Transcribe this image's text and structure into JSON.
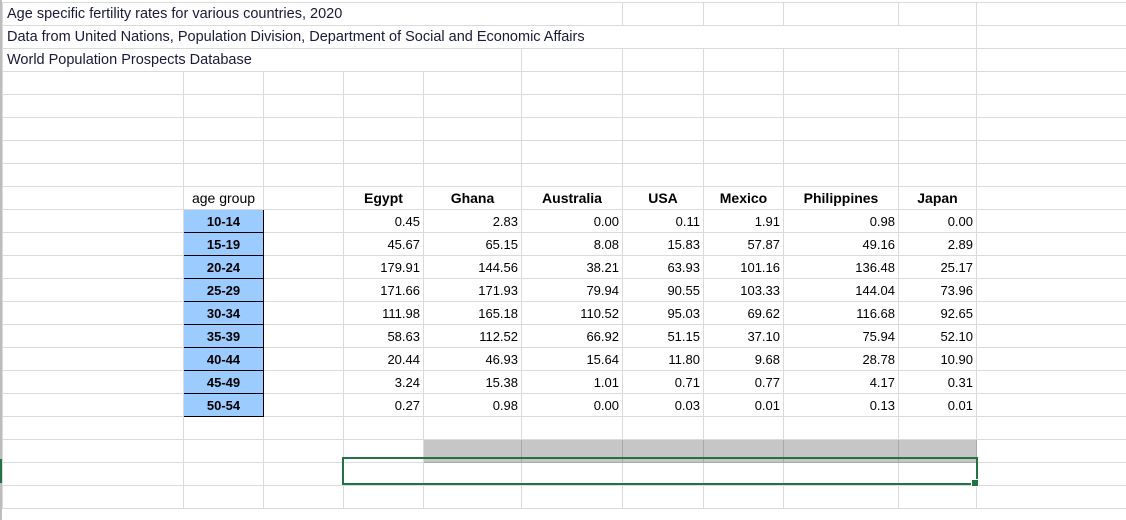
{
  "notes": [
    "Age specific fertility rates for various countries, 2020",
    "Data from United Nations, Population Division, Department of Social and Economic Affairs",
    "World Population Prospects Database"
  ],
  "table": {
    "age_header": "age group",
    "countries": [
      "Egypt",
      "Ghana",
      "Australia",
      "USA",
      "Mexico",
      "Philippines",
      "Japan"
    ],
    "rows": [
      {
        "age": "10-14",
        "values": [
          "0.45",
          "2.83",
          "0.00",
          "0.11",
          "1.91",
          "0.98",
          "0.00"
        ]
      },
      {
        "age": "15-19",
        "values": [
          "45.67",
          "65.15",
          "8.08",
          "15.83",
          "57.87",
          "49.16",
          "2.89"
        ]
      },
      {
        "age": "20-24",
        "values": [
          "179.91",
          "144.56",
          "38.21",
          "63.93",
          "101.16",
          "136.48",
          "25.17"
        ]
      },
      {
        "age": "25-29",
        "values": [
          "171.66",
          "171.93",
          "79.94",
          "90.55",
          "103.33",
          "144.04",
          "73.96"
        ]
      },
      {
        "age": "30-34",
        "values": [
          "111.98",
          "165.18",
          "110.52",
          "95.03",
          "69.62",
          "116.68",
          "92.65"
        ]
      },
      {
        "age": "35-39",
        "values": [
          "58.63",
          "112.52",
          "66.92",
          "51.15",
          "37.10",
          "75.94",
          "52.10"
        ]
      },
      {
        "age": "40-44",
        "values": [
          "20.44",
          "46.93",
          "15.64",
          "11.80",
          "9.68",
          "28.78",
          "10.90"
        ]
      },
      {
        "age": "45-49",
        "values": [
          "3.24",
          "15.38",
          "1.01",
          "0.71",
          "0.77",
          "4.17",
          "0.31"
        ]
      },
      {
        "age": "50-54",
        "values": [
          "0.27",
          "0.98",
          "0.00",
          "0.03",
          "0.01",
          "0.13",
          "0.01"
        ]
      }
    ]
  },
  "colors": {
    "age_fill": "#9ccbff",
    "selection": "#217346",
    "selection_fill": "#c6c6c6"
  }
}
